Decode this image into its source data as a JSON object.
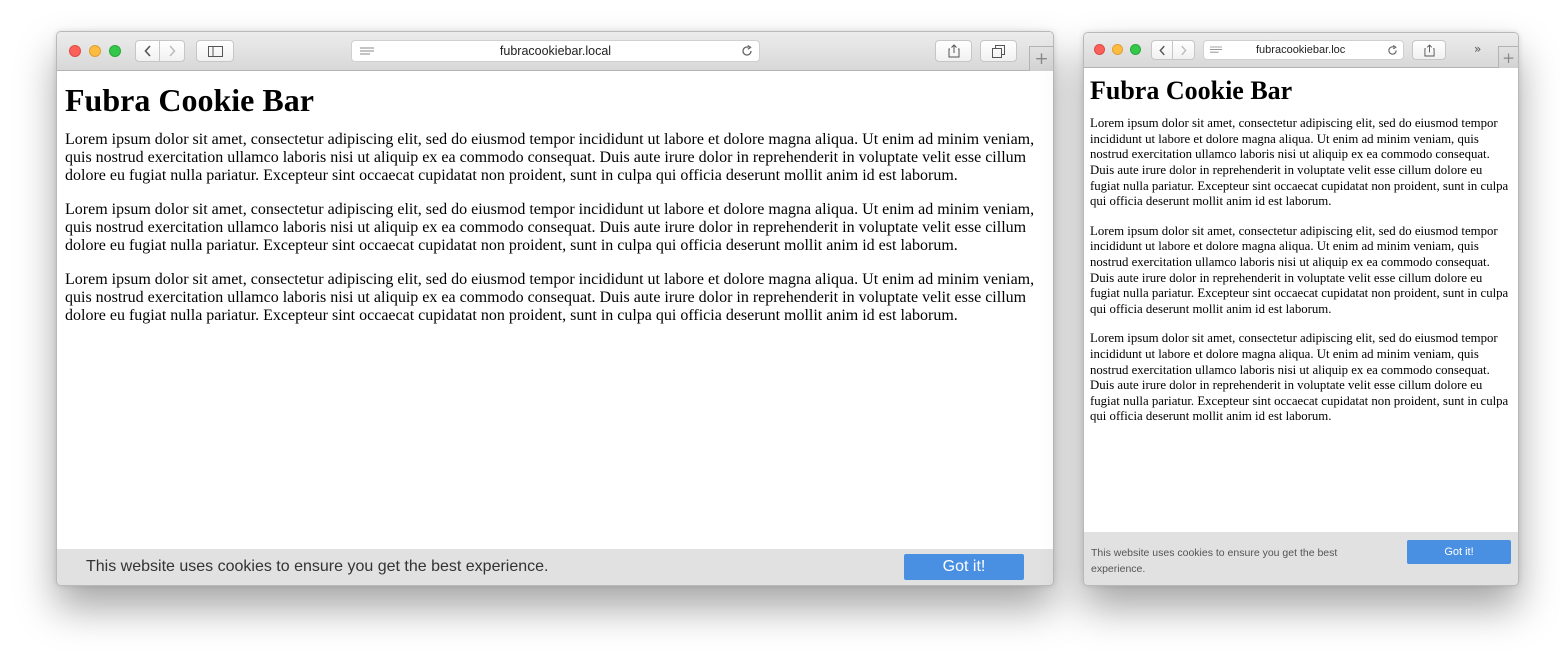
{
  "browser": {
    "url": "fubracookiebar.local",
    "url_truncated": "fubracookiebar.loc",
    "icons": {
      "back": "chevron-left-icon",
      "forward": "chevron-right-icon",
      "sidebar": "sidebar-icon",
      "reader": "reader-icon",
      "reload": "reload-icon",
      "share": "share-icon",
      "tabs": "tabs-overview-icon",
      "overflow": "double-chevron-icon",
      "new_tab": "plus-icon"
    }
  },
  "page": {
    "title": "Fubra Cookie Bar",
    "paragraphs": [
      "Lorem ipsum dolor sit amet, consectetur adipiscing elit, sed do eiusmod tempor incididunt ut labore et dolore magna aliqua. Ut enim ad minim veniam, quis nostrud exercitation ullamco laboris nisi ut aliquip ex ea commodo consequat. Duis aute irure dolor in reprehenderit in voluptate velit esse cillum dolore eu fugiat nulla pariatur. Excepteur sint occaecat cupidatat non proident, sunt in culpa qui officia deserunt mollit anim id est laborum.",
      "Lorem ipsum dolor sit amet, consectetur adipiscing elit, sed do eiusmod tempor incididunt ut labore et dolore magna aliqua. Ut enim ad minim veniam, quis nostrud exercitation ullamco laboris nisi ut aliquip ex ea commodo consequat. Duis aute irure dolor in reprehenderit in voluptate velit esse cillum dolore eu fugiat nulla pariatur. Excepteur sint occaecat cupidatat non proident, sunt in culpa qui officia deserunt mollit anim id est laborum.",
      "Lorem ipsum dolor sit amet, consectetur adipiscing elit, sed do eiusmod tempor incididunt ut labore et dolore magna aliqua. Ut enim ad minim veniam, quis nostrud exercitation ullamco laboris nisi ut aliquip ex ea commodo consequat. Duis aute irure dolor in reprehenderit in voluptate velit esse cillum dolore eu fugiat nulla pariatur. Excepteur sint occaecat cupidatat non proident, sunt in culpa qui officia deserunt mollit anim id est laborum."
    ]
  },
  "cookie_bar": {
    "message": "This website uses cookies to ensure you get the best experience.",
    "button_label": "Got it!"
  },
  "colors": {
    "button": "#4a90e2",
    "bar_background": "#e1e1e1"
  }
}
